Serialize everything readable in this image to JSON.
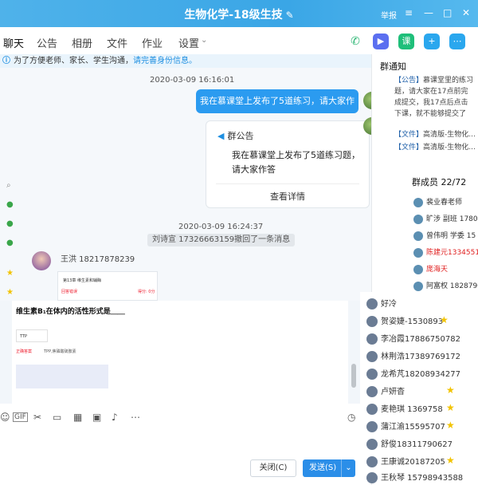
{
  "window": {
    "title": "生物化学-18级生技",
    "controls": {
      "report": "举报",
      "minimize": "—",
      "maximize": "□",
      "close": "✕"
    }
  },
  "tabs": [
    "聊天",
    "公告",
    "相册",
    "文件",
    "作业",
    "设置"
  ],
  "notice": {
    "text": "为了方便老师、家长、学生沟通，",
    "link": "请完善身份信息。"
  },
  "chat": {
    "timestamp1": "2020-03-09 16:16:01",
    "self_message": "我在慕课堂上发布了5道练习，请大家作答",
    "announcement_card": {
      "header": "群公告",
      "body": "我在慕课堂上发布了5道练习题，请大家作答",
      "more": "查看详情"
    },
    "timestamp2": "2020-03-09 16:24:37",
    "recall_notice": "刘诗宣  17326663159撤回了一条消息",
    "sender": "王洪  18217878239",
    "image_msg": {
      "row1": "第13章 维生素和辅酶",
      "row2": "回答错误",
      "row3": "得分: 0分"
    },
    "image2": {
      "question": "维生素B₁在体内的活性形式是＿＿",
      "option": "TTP",
      "answer_label": "正确答案",
      "answer": "TPP,焦磷酸硫胺素"
    }
  },
  "right_panel": {
    "notice_title": "群通知",
    "notice_items": [
      {
        "tag": "【公告】",
        "text": "慕课堂里的练习题，请大家在17点前完成提交，我17点后点击下课，就不能够提交了"
      },
      {
        "tag": "【文件】",
        "text": "高清版-生物化..."
      },
      {
        "tag": "【文件】",
        "text": "高清版-生物化..."
      }
    ],
    "members_title": "群成员 22/72",
    "members": [
      {
        "name": "裴业春老师",
        "red": false
      },
      {
        "name": "旷涉 副班 17800",
        "red": false
      },
      {
        "name": "曾伟明 学委 15",
        "red": false
      },
      {
        "name": "陈建元13345515",
        "red": true
      },
      {
        "name": "庞海天",
        "red": true
      },
      {
        "name": "阿富权 18287900",
        "red": false
      }
    ],
    "members2": [
      {
        "name": "好冷",
        "star": false
      },
      {
        "name": "贺姿婕-1530893",
        "star": true
      },
      {
        "name": "李冶霞17886750782",
        "star": false
      },
      {
        "name": "林荆浩17389769172",
        "star": false
      },
      {
        "name": "龙希芃18208934277",
        "star": false
      },
      {
        "name": "卢妍杳",
        "star": true
      },
      {
        "name": "麦艳琪 1369758",
        "star": true
      },
      {
        "name": "蒲江渝15595707",
        "star": true
      },
      {
        "name": "舒俊18311790627",
        "star": false
      },
      {
        "name": "王康诚20187205",
        "star": true
      },
      {
        "name": "王秋琴 15798943588",
        "star": false
      }
    ]
  },
  "input": {
    "close_button": "关闭(C)",
    "send_button": "发送(S)",
    "send_dropdown": "⌄"
  },
  "colors": {
    "accent": "#1e8fe1",
    "titlebar": "#3aa6e6",
    "send": "#2b8ee8"
  }
}
